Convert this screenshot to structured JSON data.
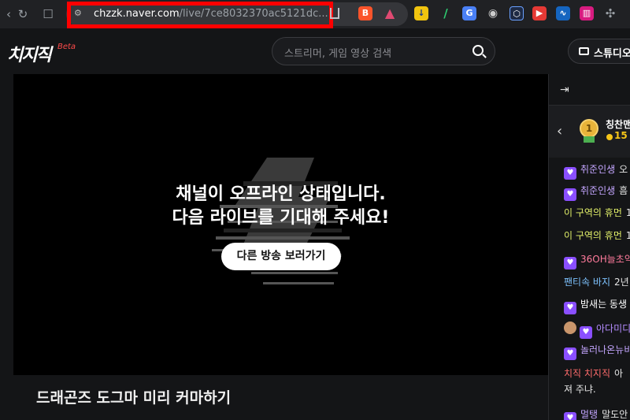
{
  "browser": {
    "url_host": "chzzk.naver.com",
    "url_path": "/live/7ce8032370ac5121dc..."
  },
  "header": {
    "logo": "치지직",
    "logo_beta": "Beta",
    "search_placeholder": "스트리머, 게임 영상 검색",
    "studio_label": "스튜디오"
  },
  "player": {
    "offline_line1": "채널이 오프라인 상태입니다.",
    "offline_line2": "다음 라이브를 기대해 주세요!",
    "other_stream_button": "다른 방송 보러가기"
  },
  "stream": {
    "title": "드래곤즈 도그마 미리 커마하기"
  },
  "chat": {
    "top_donor": {
      "name": "칭찬맨",
      "amount": "15"
    },
    "messages": [
      {
        "nick": "취준인생",
        "text": "오",
        "color": "#c4a6ff",
        "badge": true,
        "emoji": false
      },
      {
        "nick": "취준인생",
        "text": "흠",
        "color": "#c4a6ff",
        "badge": true,
        "emoji": false
      },
      {
        "nick": "이 구역의 휴먼",
        "text": "1",
        "color": "#e5f36a",
        "badge": false,
        "emoji": false
      },
      {
        "nick": "이 구역의 휴먼",
        "text": "1",
        "color": "#e5f36a",
        "badge": false,
        "emoji": false
      },
      {
        "nick": "36OH늘초약",
        "text": "",
        "color": "#ff7b9c",
        "badge": true,
        "emoji": false
      },
      {
        "nick": "팬티속 바지",
        "text": "2년",
        "color": "#7ec3ff",
        "badge": false,
        "emoji": false
      },
      {
        "nick": "밤새는 동생",
        "text": "",
        "color": "#ffffff",
        "badge": true,
        "emoji": false
      },
      {
        "nick": "아다미디",
        "text": "",
        "color": "#b48cff",
        "badge": true,
        "emoji": true
      },
      {
        "nick": "놀러나온뉴비",
        "text": "",
        "color": "#c4a6ff",
        "badge": true,
        "emoji": false
      },
      {
        "nick": "치직 치지직",
        "text": "아",
        "color": "#ff6b6b",
        "badge": false,
        "emoji": false
      },
      {
        "nick": "",
        "text": "져 주냐.",
        "color": "#e6e6e6",
        "badge": false,
        "emoji": false
      },
      {
        "nick": "멀탱",
        "text": "말도안",
        "color": "#c4a6ff",
        "badge": true,
        "emoji": false
      }
    ]
  },
  "colors": {
    "accent_red": "#ff0000",
    "chzzk_green": "#00ffa3"
  }
}
